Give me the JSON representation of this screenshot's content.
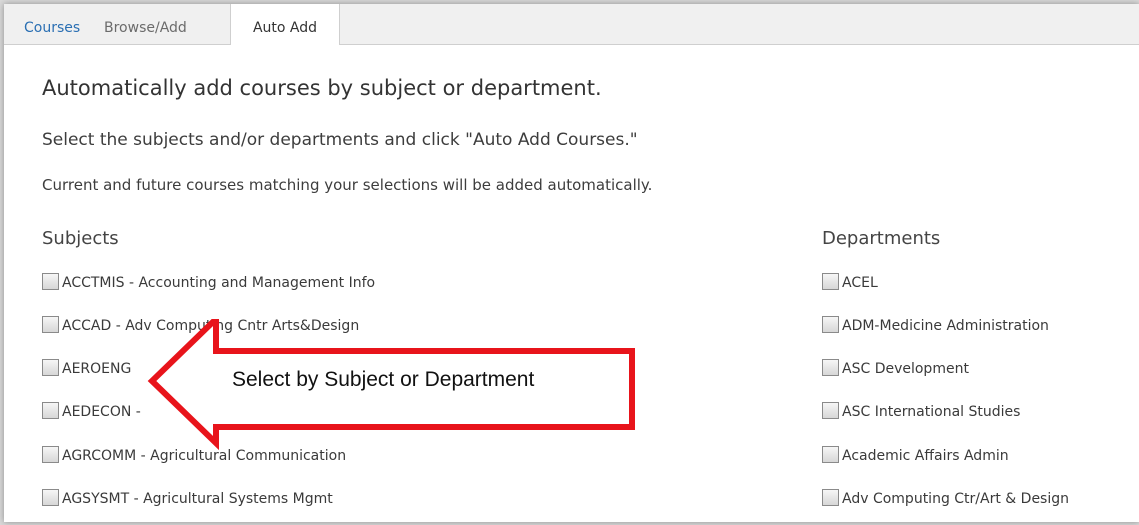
{
  "tabs": [
    {
      "label": "Courses"
    },
    {
      "label": "Browse/Add"
    },
    {
      "label": "Auto Add"
    }
  ],
  "heading": "Automatically add courses by subject or department.",
  "instructions": {
    "line1": "Select the subjects and/or departments and click \"Auto Add Courses.\"",
    "line2": "Current and future courses matching your selections will be added automatically."
  },
  "subjects": {
    "header": "Subjects",
    "items": [
      {
        "label": "ACCTMIS - Accounting and Management Info",
        "checked": false
      },
      {
        "label": "ACCAD - Adv Computing Cntr Arts&Design",
        "checked": false
      },
      {
        "label": "AEROENG",
        "checked": false
      },
      {
        "label": "AEDECON -",
        "checked": false
      },
      {
        "label": "AGRCOMM - Agricultural Communication",
        "checked": false
      },
      {
        "label": "AGSYSMT - Agricultural Systems Mgmt",
        "checked": false
      }
    ]
  },
  "departments": {
    "header": "Departments",
    "items": [
      {
        "label": "ACEL",
        "checked": false
      },
      {
        "label": "ADM-Medicine Administration",
        "checked": false
      },
      {
        "label": "ASC Development",
        "checked": false
      },
      {
        "label": "ASC International Studies",
        "checked": false
      },
      {
        "label": "Academic Affairs Admin",
        "checked": false
      },
      {
        "label": "Adv Computing Ctr/Art & Design",
        "checked": false
      }
    ]
  },
  "callout": {
    "text": "Select by Subject or Department",
    "color": "#e8141b"
  },
  "colors": {
    "tab_active_link": "#2a6fb3",
    "text": "#333333"
  }
}
